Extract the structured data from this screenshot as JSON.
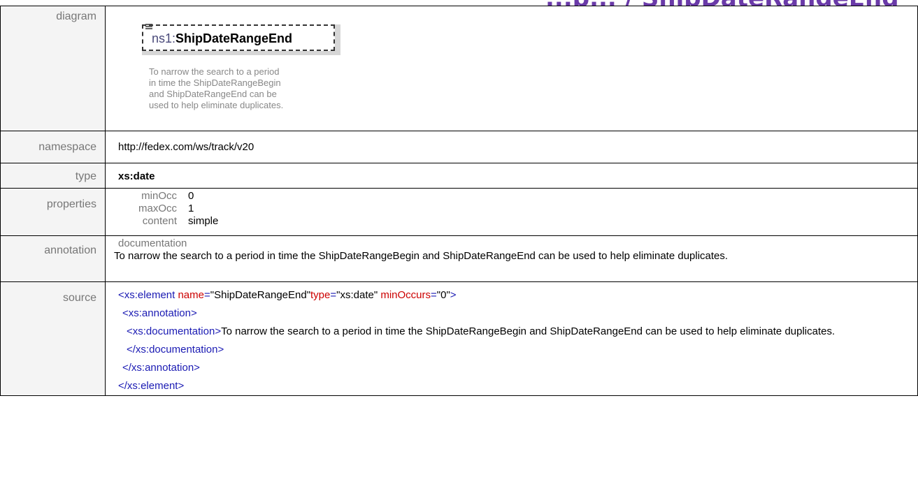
{
  "page_heading": "...p... / ShipDateRangeEnd",
  "labels": {
    "diagram": "diagram",
    "namespace": "namespace",
    "type": "type",
    "properties": "properties",
    "annotation": "annotation",
    "source": "source"
  },
  "diagram": {
    "prefix": "ns1:",
    "name": "ShipDateRangeEnd",
    "doc_lines": [
      "To narrow the search to a period",
      "in time the ShipDateRangeBegin",
      "and ShipDateRangeEnd can be",
      "used to help eliminate duplicates."
    ]
  },
  "namespace": "http://fedex.com/ws/track/v20",
  "type": "xs:date",
  "properties": [
    {
      "key": "minOcc",
      "value": "0"
    },
    {
      "key": "maxOcc",
      "value": "1"
    },
    {
      "key": "content",
      "value": "simple"
    }
  ],
  "annotation": {
    "key": "documentation",
    "text": "To narrow the search to a period in time the ShipDateRangeBegin and ShipDateRangeEnd can be used to help eliminate duplicates."
  },
  "source": {
    "line1_tag_open": "<xs:element",
    "attr_name": "name",
    "val_name": "\"ShipDateRangeEnd\"",
    "attr_type": "type",
    "val_type": "\"xs:date\"",
    "attr_min": "minOccurs",
    "val_min": "\"0\"",
    "close_bracket": ">",
    "line2": "<xs:annotation>",
    "line3_open": "<xs:documentation>",
    "doc_text": "To narrow the search to a period in time the ShipDateRangeBegin and ShipDateRangeEnd can be used to help eliminate duplicates.",
    "line3_close": "</xs:documentation>",
    "line4": "</xs:annotation>",
    "line5": "</xs:element>"
  },
  "colors": {
    "tag": "#1a1ab3",
    "attr": "#cc0000",
    "heading": "#6a3aa8"
  }
}
